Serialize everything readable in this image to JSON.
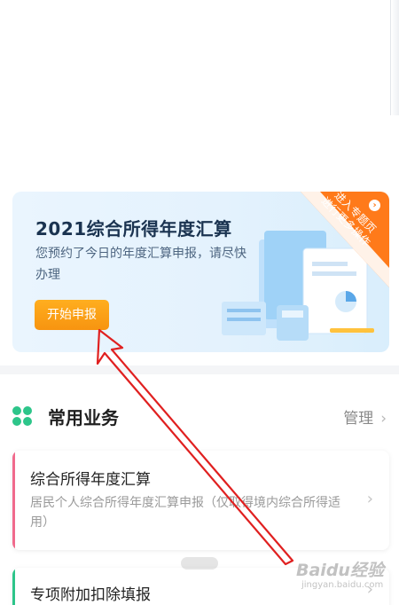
{
  "banner": {
    "title": "2021综合所得年度汇算",
    "subtitle": "您预约了今日的年度汇算申报，请尽快办理",
    "button": "开始申报",
    "corner_line1": "进入专题页",
    "corner_line2": "进行更多操作",
    "corner_icon": "chevron-right-icon"
  },
  "common": {
    "title": "常用业务",
    "manage_label": "管理"
  },
  "cards": [
    {
      "title": "综合所得年度汇算",
      "desc": "居民个人综合所得年度汇算申报（仅取得境内综合所得适用）",
      "accent": "#f06a8c"
    },
    {
      "title": "专项附加扣除填报",
      "accent": "#2dc58a"
    }
  ],
  "watermark": {
    "main": "Baidu经验",
    "sub": "jingyan.baidu.com"
  },
  "colors": {
    "primary_button": "#f79410",
    "corner_ribbon": "#ff7a1a",
    "annotation_arrow": "#e02020",
    "clover": "#2dc58a"
  }
}
